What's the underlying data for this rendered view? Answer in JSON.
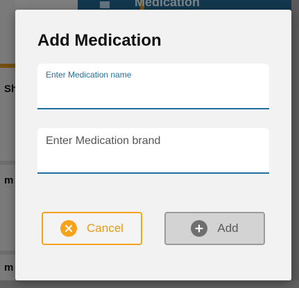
{
  "background": {
    "header_title": "Medication",
    "left_fragments": [
      "Sh",
      "m",
      "m"
    ]
  },
  "dialog": {
    "title": "Add Medication",
    "medication_name": {
      "label": "Enter Medication name",
      "value": ""
    },
    "medication_brand": {
      "placeholder": "Enter Medication brand",
      "value": ""
    },
    "cancel_button": {
      "label": "Cancel",
      "icon": "close-circle-icon",
      "color": "#f5a31a"
    },
    "add_button": {
      "label": "Add",
      "icon": "plus-circle-icon",
      "state": "disabled"
    }
  },
  "colors": {
    "accent_blue": "#1f6f9e",
    "accent_orange": "#f5a31a",
    "header_blue": "#1f5f86"
  }
}
